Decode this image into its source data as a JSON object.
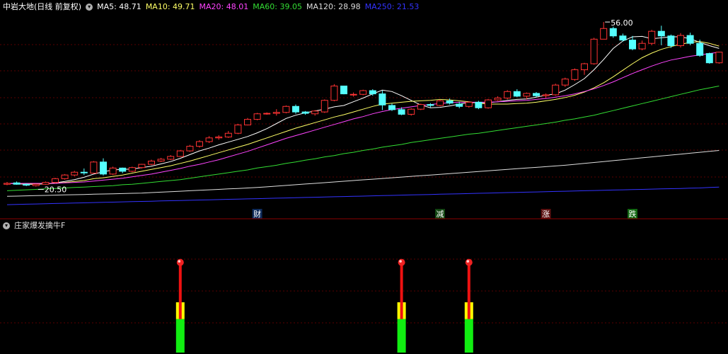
{
  "header": {
    "title": "中岩大地(日线 前复权)",
    "ma": [
      {
        "label": "MA5: 48.71",
        "color": "#ffffff"
      },
      {
        "label": "MA10: 49.71",
        "color": "#ffff66"
      },
      {
        "label": "MA20: 48.01",
        "color": "#ff44ff"
      },
      {
        "label": "MA60: 39.05",
        "color": "#33dd33"
      },
      {
        "label": "MA120: 28.98",
        "color": "#dddddd"
      },
      {
        "label": "MA250: 21.53",
        "color": "#3333ff"
      }
    ]
  },
  "indicator": {
    "title": "庄家爆发擒牛F"
  },
  "annotations": {
    "high": "56.00",
    "low": "20.50"
  },
  "markers": [
    {
      "label": "财",
      "bg": "#0d2a5a",
      "color": "#ffffff"
    },
    {
      "label": "减",
      "bg": "#114411",
      "color": "#ffffff"
    },
    {
      "label": "涨",
      "bg": "#5a1010",
      "color": "#ffffff"
    },
    {
      "label": "跌",
      "bg": "#116611",
      "color": "#ffffff"
    }
  ],
  "chart_data": {
    "type": "candlestick",
    "colors": {
      "up": "#ff3333",
      "down": "#55ffff"
    },
    "candles": [
      [
        21.0,
        21.5,
        20.8,
        21.2
      ],
      [
        21.3,
        21.6,
        20.9,
        21.0
      ],
      [
        21.0,
        21.2,
        20.6,
        20.8
      ],
      [
        20.7,
        21.1,
        20.5,
        21.0
      ],
      [
        21.0,
        21.6,
        20.9,
        21.4
      ],
      [
        21.4,
        22.4,
        21.2,
        22.2
      ],
      [
        22.2,
        23.2,
        22.0,
        23.0
      ],
      [
        23.0,
        23.9,
        22.7,
        23.6
      ],
      [
        23.6,
        24.4,
        23.0,
        23.5
      ],
      [
        23.4,
        26.0,
        23.3,
        25.8
      ],
      [
        25.8,
        26.6,
        22.9,
        23.2
      ],
      [
        23.2,
        24.8,
        23.0,
        24.5
      ],
      [
        24.5,
        24.6,
        23.4,
        23.8
      ],
      [
        23.8,
        24.8,
        23.6,
        24.6
      ],
      [
        24.6,
        25.4,
        24.4,
        25.3
      ],
      [
        25.3,
        26.3,
        25.1,
        26.0
      ],
      [
        26.0,
        26.7,
        25.8,
        26.4
      ],
      [
        26.4,
        27.3,
        26.2,
        27.0
      ],
      [
        27.0,
        28.4,
        26.9,
        28.2
      ],
      [
        28.2,
        29.5,
        28.0,
        29.2
      ],
      [
        29.2,
        30.5,
        28.9,
        30.2
      ],
      [
        30.2,
        31.4,
        29.9,
        31.0
      ],
      [
        31.0,
        31.6,
        30.6,
        31.2
      ],
      [
        31.2,
        32.5,
        31.0,
        32.0
      ],
      [
        32.0,
        34.0,
        31.8,
        33.8
      ],
      [
        33.8,
        35.3,
        33.7,
        35.0
      ],
      [
        35.0,
        36.4,
        34.8,
        36.2
      ],
      [
        36.3,
        36.5,
        36.0,
        36.3
      ],
      [
        36.3,
        37.2,
        35.8,
        36.5
      ],
      [
        36.5,
        38.0,
        36.3,
        37.8
      ],
      [
        37.8,
        38.2,
        36.2,
        36.6
      ],
      [
        36.6,
        36.8,
        36.0,
        36.3
      ],
      [
        36.2,
        37.0,
        35.8,
        36.8
      ],
      [
        36.6,
        39.3,
        36.4,
        39.1
      ],
      [
        39.1,
        42.6,
        38.9,
        42.2
      ],
      [
        42.2,
        41.7,
        40.4,
        40.5
      ],
      [
        40.3,
        40.8,
        39.9,
        40.4
      ],
      [
        40.4,
        41.4,
        40.2,
        41.2
      ],
      [
        41.2,
        41.5,
        40.1,
        40.5
      ],
      [
        40.5,
        41.2,
        37.0,
        38.1
      ],
      [
        38.0,
        38.4,
        36.8,
        37.1
      ],
      [
        37.1,
        37.6,
        35.9,
        36.1
      ],
      [
        36.1,
        37.4,
        35.8,
        37.2
      ],
      [
        37.2,
        38.4,
        37.0,
        38.2
      ],
      [
        38.2,
        38.5,
        37.6,
        38.0
      ],
      [
        38.0,
        39.3,
        37.8,
        39.0
      ],
      [
        39.0,
        39.5,
        38.2,
        38.5
      ],
      [
        38.3,
        38.8,
        37.4,
        37.8
      ],
      [
        37.8,
        38.9,
        37.5,
        38.7
      ],
      [
        38.7,
        39.0,
        37.2,
        37.5
      ],
      [
        37.5,
        39.4,
        37.3,
        39.2
      ],
      [
        39.2,
        40.0,
        39.0,
        39.6
      ],
      [
        39.6,
        41.3,
        39.3,
        41.0
      ],
      [
        41.0,
        41.5,
        39.8,
        40.0
      ],
      [
        40.0,
        40.8,
        39.3,
        40.6
      ],
      [
        40.6,
        40.9,
        39.8,
        40.1
      ],
      [
        40.1,
        40.6,
        39.6,
        40.3
      ],
      [
        40.3,
        42.7,
        40.1,
        42.4
      ],
      [
        42.4,
        44.0,
        42.0,
        43.7
      ],
      [
        43.6,
        46.0,
        43.3,
        45.7
      ],
      [
        45.7,
        47.2,
        44.6,
        47.0
      ],
      [
        47.0,
        52.6,
        46.8,
        52.3
      ],
      [
        52.3,
        56.0,
        53.8,
        54.6
      ],
      [
        54.6,
        55.0,
        52.6,
        53.0
      ],
      [
        53.0,
        53.5,
        51.8,
        52.1
      ],
      [
        52.1,
        53.0,
        49.9,
        50.2
      ],
      [
        50.2,
        52.0,
        49.9,
        51.4
      ],
      [
        51.4,
        54.3,
        51.0,
        54.0
      ],
      [
        54.0,
        55.2,
        51.0,
        53.0
      ],
      [
        53.0,
        53.3,
        50.4,
        50.9
      ],
      [
        50.9,
        53.6,
        50.5,
        53.1
      ],
      [
        53.1,
        53.7,
        51.0,
        51.4
      ],
      [
        51.4,
        52.2,
        48.5,
        48.8
      ],
      [
        49.2,
        49.4,
        47.0,
        47.2
      ],
      [
        47.2,
        49.6,
        47.0,
        49.5
      ]
    ],
    "ma_lines": [
      {
        "name": "MA5",
        "color": "#ffffff",
        "values": [
          21.2,
          21.1,
          21.0,
          21.0,
          21.1,
          21.3,
          21.6,
          22.0,
          22.5,
          23.2,
          23.7,
          24.1,
          24.2,
          24.3,
          24.6,
          24.9,
          25.4,
          25.9,
          26.6,
          27.4,
          28.2,
          28.8,
          29.5,
          30.1,
          30.7,
          31.3,
          32.1,
          33.0,
          34.1,
          35.2,
          35.9,
          36.4,
          36.8,
          37.2,
          37.7,
          38.0,
          38.8,
          39.6,
          40.5,
          41.3,
          41.0,
          40.1,
          39.1,
          38.1,
          37.5,
          37.6,
          37.9,
          38.3,
          38.6,
          38.6,
          38.6,
          38.8,
          39.1,
          39.3,
          39.4,
          39.8,
          40.2,
          40.5,
          41.3,
          42.5,
          43.8,
          45.7,
          47.9,
          50.3,
          51.9,
          52.8,
          52.9,
          52.4,
          52.6,
          52.8,
          52.8,
          52.4,
          51.6,
          50.9,
          50.3
        ]
      },
      {
        "name": "MA10",
        "color": "#ffff66",
        "values": [
          21.2,
          21.2,
          21.1,
          21.1,
          21.1,
          21.2,
          21.4,
          21.6,
          21.8,
          22.2,
          22.4,
          22.7,
          23.0,
          23.4,
          23.8,
          24.2,
          24.6,
          25.0,
          25.5,
          26.0,
          26.6,
          27.2,
          27.8,
          28.4,
          29.0,
          29.6,
          30.3,
          31.0,
          31.7,
          32.4,
          33.1,
          33.7,
          34.3,
          34.9,
          35.5,
          36.0,
          36.6,
          37.2,
          37.8,
          38.3,
          38.5,
          38.7,
          38.9,
          39.0,
          39.1,
          39.3,
          39.2,
          39.0,
          38.8,
          38.5,
          38.3,
          38.3,
          38.3,
          38.4,
          38.5,
          38.7,
          39.0,
          39.3,
          39.7,
          40.2,
          40.9,
          41.8,
          42.9,
          44.2,
          45.6,
          47.0,
          48.3,
          49.3,
          50.1,
          50.7,
          51.2,
          51.6,
          51.8,
          51.4,
          50.8
        ]
      },
      {
        "name": "MA20",
        "color": "#ff44ff",
        "values": [
          21.2,
          21.2,
          21.2,
          21.2,
          21.2,
          21.2,
          21.3,
          21.4,
          21.5,
          21.7,
          21.9,
          22.1,
          22.3,
          22.6,
          22.9,
          23.2,
          23.6,
          24.0,
          24.4,
          24.9,
          25.3,
          25.8,
          26.3,
          26.9,
          27.5,
          28.1,
          28.8,
          29.5,
          30.2,
          30.9,
          31.5,
          32.1,
          32.7,
          33.3,
          33.9,
          34.5,
          35.1,
          35.6,
          36.2,
          36.7,
          37.1,
          37.4,
          37.7,
          38.0,
          38.2,
          38.4,
          38.6,
          38.7,
          38.7,
          38.7,
          38.7,
          38.8,
          38.9,
          39.0,
          39.1,
          39.3,
          39.5,
          39.8,
          40.1,
          40.5,
          41.0,
          41.6,
          42.3,
          43.1,
          44.0,
          44.9,
          45.7,
          46.5,
          47.2,
          47.8,
          48.2,
          48.6,
          48.9,
          49.2,
          49.5
        ]
      },
      {
        "name": "MA60",
        "color": "#33dd33",
        "values": [
          19.6,
          19.7,
          19.8,
          19.9,
          20.0,
          20.1,
          20.2,
          20.3,
          20.4,
          20.5,
          20.6,
          20.7,
          20.9,
          21.0,
          21.2,
          21.4,
          21.6,
          21.8,
          22.0,
          22.3,
          22.6,
          22.9,
          23.2,
          23.5,
          23.8,
          24.1,
          24.5,
          24.8,
          25.1,
          25.5,
          25.8,
          26.2,
          26.5,
          26.9,
          27.2,
          27.6,
          27.9,
          28.3,
          28.6,
          29.0,
          29.3,
          29.6,
          30.0,
          30.3,
          30.6,
          30.9,
          31.2,
          31.5,
          31.8,
          32.0,
          32.3,
          32.6,
          32.9,
          33.2,
          33.5,
          33.8,
          34.1,
          34.4,
          34.8,
          35.1,
          35.5,
          35.9,
          36.4,
          36.9,
          37.4,
          37.9,
          38.4,
          38.9,
          39.4,
          39.9,
          40.4,
          40.9,
          41.4,
          41.8,
          42.2
        ]
      },
      {
        "name": "MA120",
        "color": "#dddddd",
        "values": [
          18.4,
          18.45,
          18.5,
          18.55,
          18.6,
          18.65,
          18.7,
          18.75,
          18.8,
          18.85,
          18.9,
          18.95,
          19.0,
          19.05,
          19.1,
          19.2,
          19.3,
          19.4,
          19.5,
          19.6,
          19.7,
          19.8,
          19.9,
          20.0,
          20.1,
          20.2,
          20.3,
          20.45,
          20.6,
          20.75,
          20.9,
          21.05,
          21.2,
          21.35,
          21.5,
          21.65,
          21.8,
          21.95,
          22.1,
          22.25,
          22.4,
          22.55,
          22.7,
          22.85,
          23.0,
          23.15,
          23.3,
          23.45,
          23.6,
          23.75,
          23.9,
          24.05,
          24.2,
          24.35,
          24.5,
          24.65,
          24.8,
          24.95,
          25.1,
          25.3,
          25.5,
          25.7,
          25.9,
          26.1,
          26.3,
          26.5,
          26.7,
          26.9,
          27.1,
          27.3,
          27.5,
          27.7,
          27.9,
          28.1,
          28.3
        ]
      },
      {
        "name": "MA250",
        "color": "#3333ff",
        "values": [
          16.6,
          16.65,
          16.7,
          16.75,
          16.8,
          16.85,
          16.9,
          16.95,
          17.0,
          17.05,
          17.1,
          17.15,
          17.2,
          17.25,
          17.3,
          17.35,
          17.4,
          17.45,
          17.5,
          17.55,
          17.6,
          17.65,
          17.7,
          17.75,
          17.8,
          17.85,
          17.9,
          17.95,
          18.0,
          18.05,
          18.1,
          18.15,
          18.2,
          18.25,
          18.3,
          18.35,
          18.4,
          18.45,
          18.5,
          18.55,
          18.6,
          18.65,
          18.7,
          18.75,
          18.8,
          18.85,
          18.9,
          18.95,
          19.0,
          19.05,
          19.1,
          19.15,
          19.2,
          19.25,
          19.3,
          19.35,
          19.4,
          19.45,
          19.5,
          19.55,
          19.6,
          19.65,
          19.7,
          19.75,
          19.8,
          19.85,
          19.9,
          19.95,
          20.0,
          20.05,
          20.1,
          20.15,
          20.2,
          20.3,
          20.4
        ]
      }
    ],
    "event_candle_index": [
      26,
      45,
      56,
      65
    ],
    "signal_candle_index": [
      18,
      41,
      48
    ],
    "signal_bar": {
      "top_red": 0.8,
      "yellow": 0.45,
      "green": 0.3
    },
    "ylim": [
      16,
      58
    ]
  }
}
